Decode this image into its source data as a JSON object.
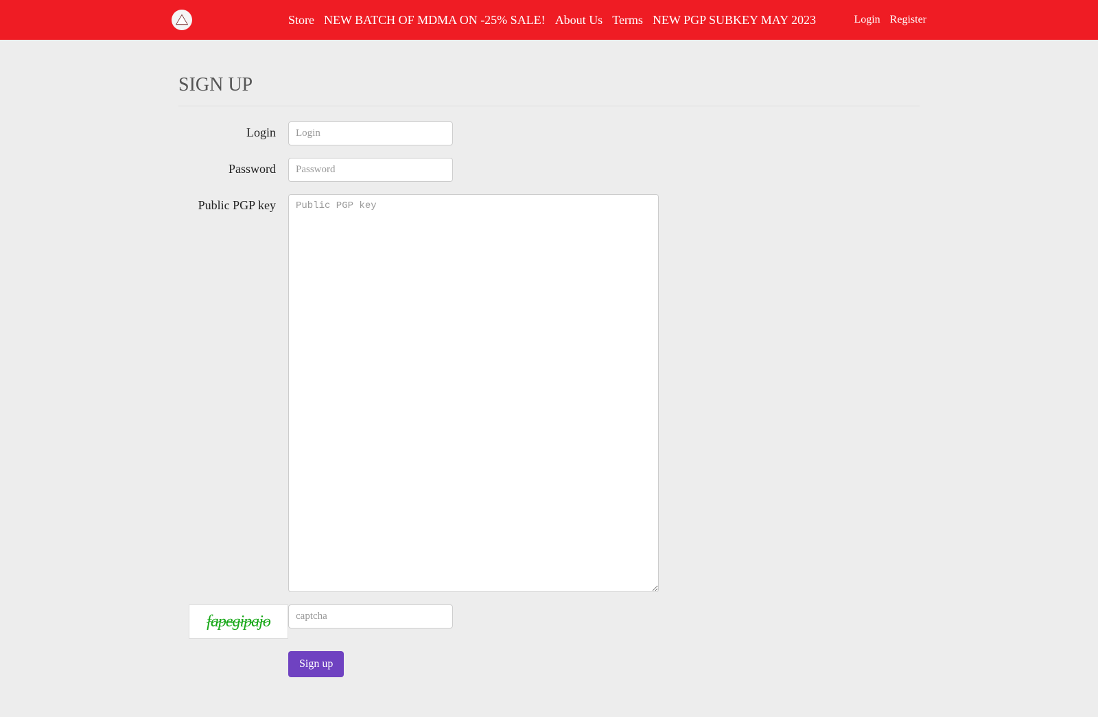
{
  "nav": {
    "left": [
      {
        "label": "Store"
      },
      {
        "label": "NEW BATCH OF MDMA ON -25% SALE!"
      },
      {
        "label": "About Us"
      },
      {
        "label": "Terms"
      },
      {
        "label": "NEW PGP SUBKEY MAY 2023"
      }
    ],
    "right": [
      {
        "label": "Login"
      },
      {
        "label": "Register"
      }
    ]
  },
  "page": {
    "title": "SIGN UP"
  },
  "form": {
    "login_label": "Login",
    "login_placeholder": "Login",
    "password_label": "Password",
    "password_placeholder": "Password",
    "pgp_label": "Public PGP key",
    "pgp_placeholder": "Public PGP key",
    "captcha_placeholder": "captcha",
    "captcha_text": "fapegipajo",
    "submit_label": "Sign up"
  }
}
